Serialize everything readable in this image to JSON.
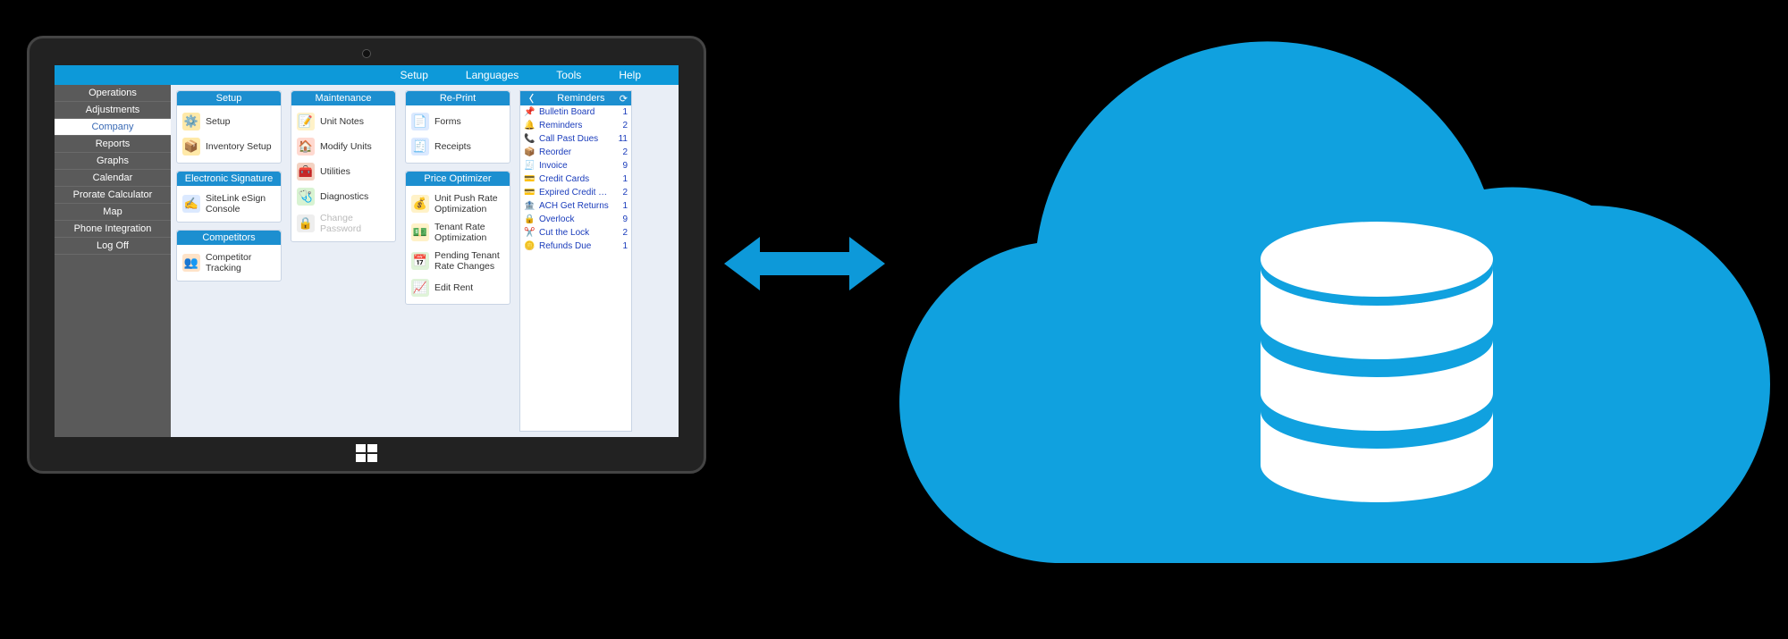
{
  "menubar": {
    "setup": "Setup",
    "languages": "Languages",
    "tools": "Tools",
    "help": "Help"
  },
  "sidebar": {
    "items": [
      {
        "label": "Operations"
      },
      {
        "label": "Adjustments"
      },
      {
        "label": "Company"
      },
      {
        "label": "Reports"
      },
      {
        "label": "Graphs"
      },
      {
        "label": "Calendar"
      },
      {
        "label": "Prorate Calculator"
      },
      {
        "label": "Map"
      },
      {
        "label": "Phone Integration"
      },
      {
        "label": "Log Off"
      }
    ],
    "selected_index": 2
  },
  "panels": {
    "setup": {
      "title": "Setup",
      "items": [
        {
          "label": "Setup"
        },
        {
          "label": "Inventory Setup"
        }
      ]
    },
    "esign": {
      "title": "Electronic Signature",
      "items": [
        {
          "label": "SiteLink eSign Console"
        }
      ]
    },
    "competitors": {
      "title": "Competitors",
      "items": [
        {
          "label": "Competitor Tracking"
        }
      ]
    },
    "maintenance": {
      "title": "Maintenance",
      "items": [
        {
          "label": "Unit Notes"
        },
        {
          "label": "Modify Units"
        },
        {
          "label": "Utilities"
        },
        {
          "label": "Diagnostics"
        },
        {
          "label": "Change Password"
        }
      ]
    },
    "reprint": {
      "title": "Re-Print",
      "items": [
        {
          "label": "Forms"
        },
        {
          "label": "Receipts"
        }
      ]
    },
    "priceopt": {
      "title": "Price Optimizer",
      "items": [
        {
          "label": "Unit Push Rate Optimization"
        },
        {
          "label": "Tenant Rate Optimization"
        },
        {
          "label": "Pending Tenant Rate Changes"
        },
        {
          "label": "Edit Rent"
        }
      ]
    }
  },
  "reminders": {
    "title": "Reminders",
    "rows": [
      {
        "label": "Bulletin Board",
        "count": 1
      },
      {
        "label": "Reminders",
        "count": 2
      },
      {
        "label": "Call Past Dues",
        "count": 11
      },
      {
        "label": "Reorder",
        "count": 2
      },
      {
        "label": "Invoice",
        "count": 9
      },
      {
        "label": "Credit Cards",
        "count": 1
      },
      {
        "label": "Expired Credit Car...",
        "count": 2
      },
      {
        "label": "ACH Get Returns",
        "count": 1
      },
      {
        "label": "Overlock",
        "count": 9
      },
      {
        "label": "Cut the Lock",
        "count": 2
      },
      {
        "label": "Refunds Due",
        "count": 1
      }
    ]
  },
  "colors": {
    "primary": "#0d99d9",
    "cloud": "#10a1df"
  }
}
